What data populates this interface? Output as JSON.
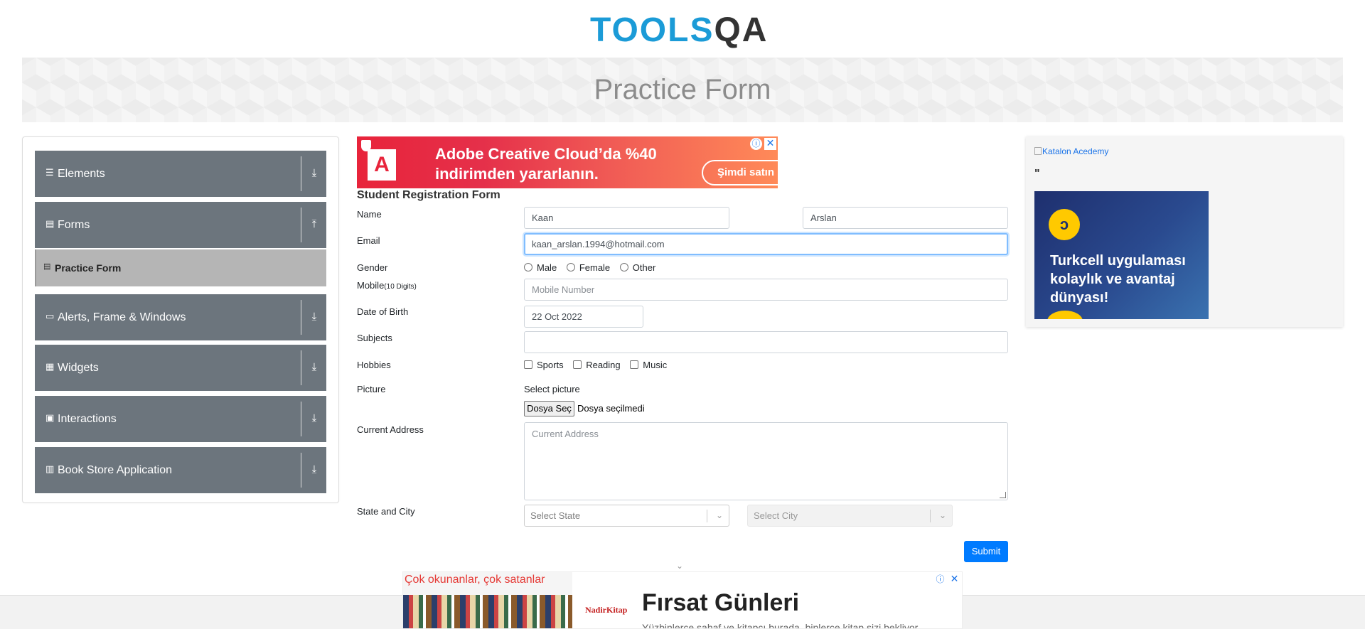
{
  "header": {
    "logo_tools": "TOOLS",
    "logo_qa": "QA"
  },
  "banner": {
    "title": "Practice Form"
  },
  "sidebar": {
    "groups": [
      {
        "label": "Elements",
        "icon": "menu-icon",
        "arrow": "download-icon"
      },
      {
        "label": "Forms",
        "icon": "form-icon",
        "arrow": "upload-icon"
      },
      {
        "label": "Alerts, Frame & Windows",
        "icon": "window-icon",
        "arrow": "download-icon"
      },
      {
        "label": "Widgets",
        "icon": "widgets-icon",
        "arrow": "download-icon"
      },
      {
        "label": "Interactions",
        "icon": "interactions-icon",
        "arrow": "download-icon"
      },
      {
        "label": "Book Store Application",
        "icon": "books-icon",
        "arrow": "download-icon"
      }
    ],
    "active_item": "Practice Form",
    "accent_color": "#6c757d"
  },
  "ad_top": {
    "line1": "Adobe Creative Cloud’da %40",
    "line2": "indirimden yararlanın.",
    "cta": "Şimdi satın",
    "logo": "A"
  },
  "form": {
    "title": "Student Registration Form",
    "labels": {
      "name": "Name",
      "email": "Email",
      "gender": "Gender",
      "mobile": "Mobile",
      "mobile_hint": "(10 Digits)",
      "dob": "Date of Birth",
      "subjects": "Subjects",
      "hobbies": "Hobbies",
      "picture": "Picture",
      "address": "Current Address",
      "state_city": "State and City"
    },
    "first_name": "Kaan",
    "last_name": "Arslan",
    "email": "kaan_arslan.1994@hotmail.com",
    "gender_options": [
      "Male",
      "Female",
      "Other"
    ],
    "mobile_placeholder": "Mobile Number",
    "dob": "22 Oct 2022",
    "subjects": "",
    "hobby_options": [
      "Sports",
      "Reading",
      "Music"
    ],
    "select_picture": "Select picture",
    "file_button": "Dosya Seç",
    "file_status": "Dosya seçilmedi",
    "address_placeholder": "Current Address",
    "state_placeholder": "Select State",
    "city_placeholder": "Select City",
    "submit": "Submit",
    "submit_color": "#007bff"
  },
  "ad_right": {
    "image_alt": "Katalon Acedemy",
    "quote": "\"",
    "turkcell_text_1": "Turkcell uygulaması",
    "turkcell_text_2": "kolaylık ve avantaj",
    "turkcell_text_3": "dünyası!"
  },
  "ad_bottom": {
    "left_head": "Çok okunanlar, çok satanlar",
    "logo": "NadirKitap",
    "title": "Fırsat Günleri",
    "subtitle": "Yüzbinlerce sahaf ve kitapçı burada, binlerce kitap sizi bekliyor."
  }
}
